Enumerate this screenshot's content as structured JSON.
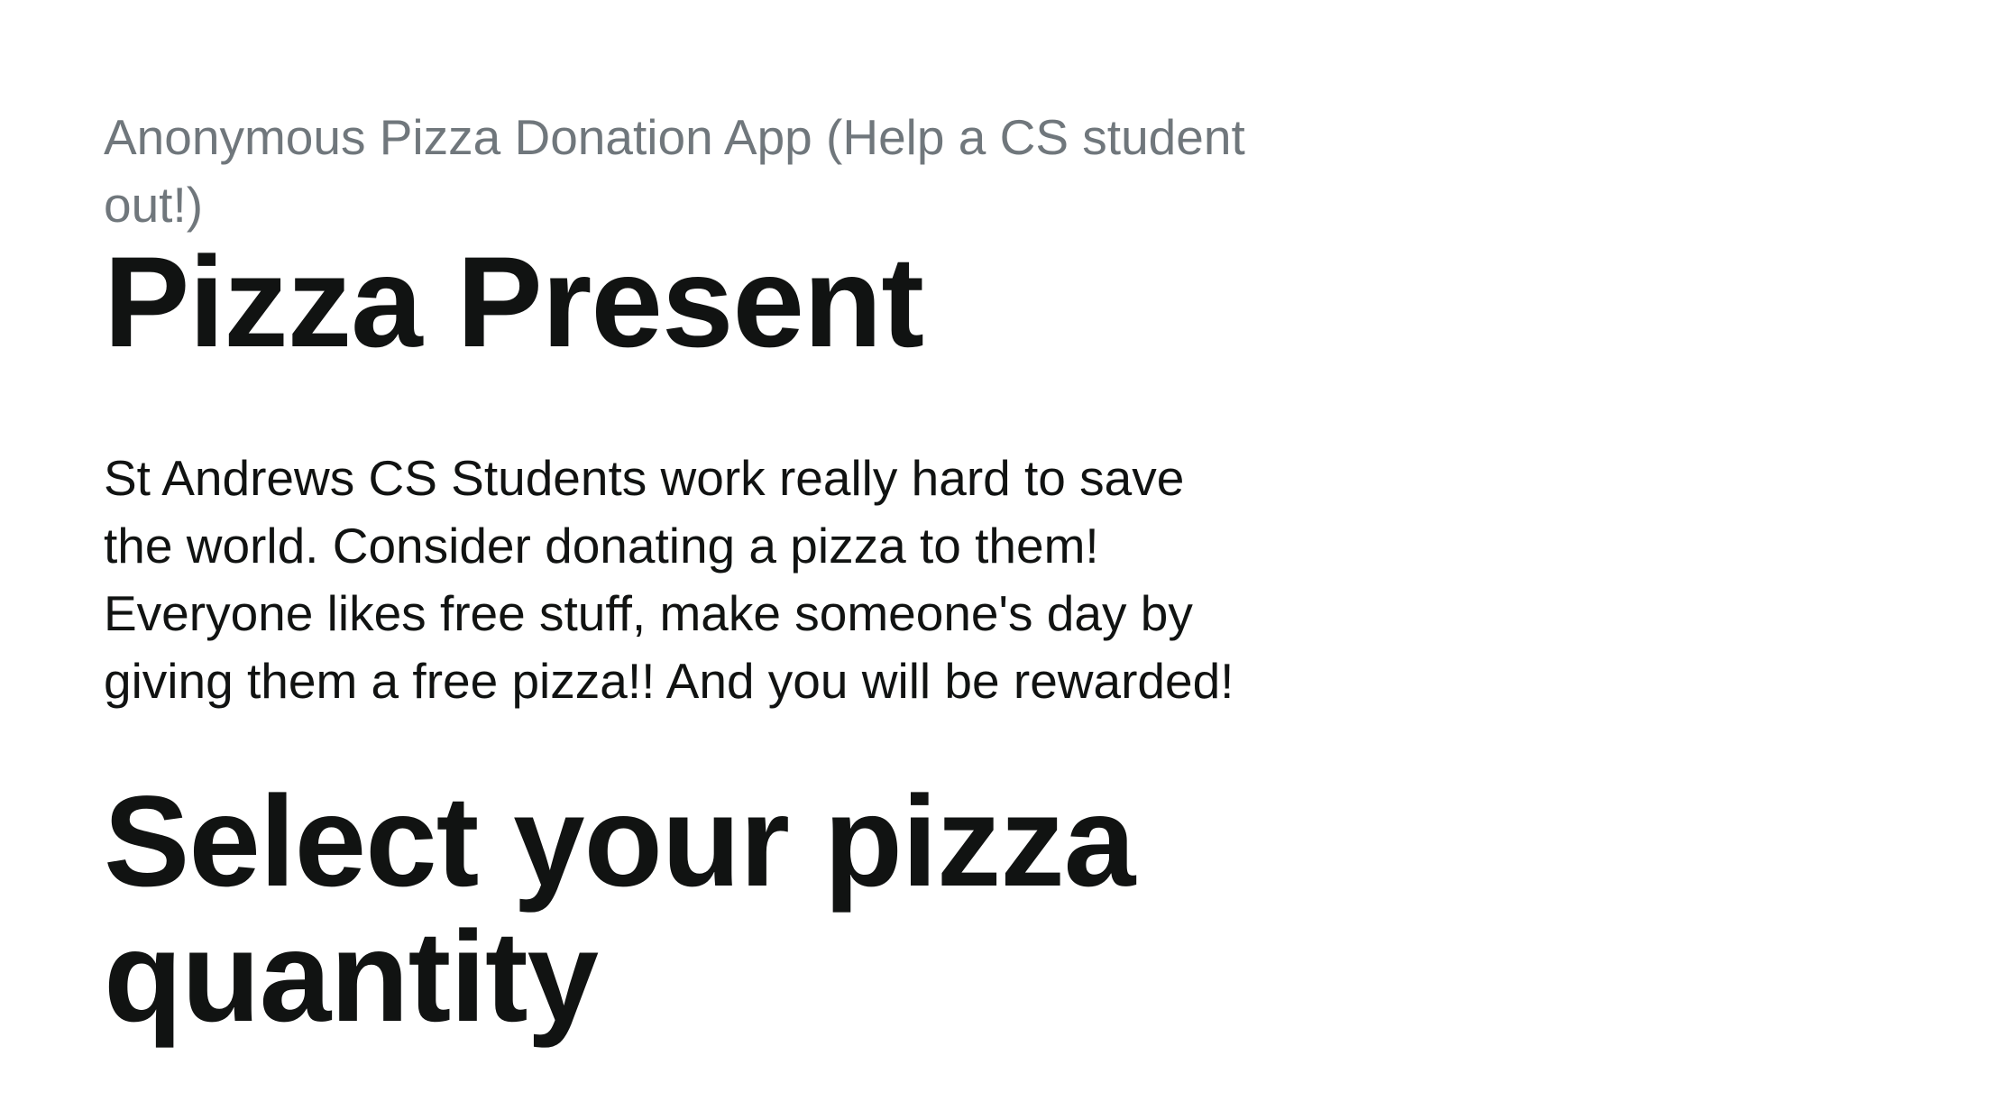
{
  "header": {
    "eyebrow": "Anonymous Pizza Donation App (Help a CS student out!)",
    "title": "Pizza Present"
  },
  "main": {
    "intro": "St Andrews CS Students work really hard to save the world. Consider donating a pizza to them! Everyone likes free stuff, make someone's day by giving them a free pizza!! And you will be rewarded!",
    "section_heading": "Select your pizza quantity"
  },
  "colors": {
    "background": "#ffffff",
    "text": "#111312",
    "muted_text": "#70777c"
  }
}
